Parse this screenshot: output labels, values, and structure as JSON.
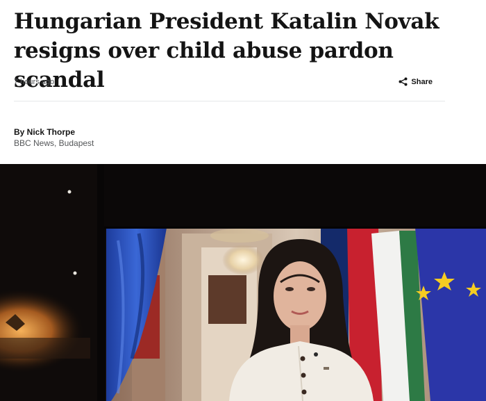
{
  "article": {
    "headline": "Hungarian President Katalin Novak resigns over child abuse pardon scandal",
    "timestamp": "7 hours ago",
    "share_label": "Share",
    "byline_author": "By Nick Thorpe",
    "byline_org": "BBC News, Budapest"
  },
  "photo": {
    "description_icon": "news-photo",
    "colors": {
      "flag_red": "#c8212f",
      "flag_white": "#f2f2f0",
      "flag_green": "#2d7a45",
      "eu_blue": "#2b36a8",
      "eu_star": "#f5cc22",
      "curtain_blue": "#2c55c4"
    }
  },
  "icons": {
    "share": "share-icon"
  }
}
